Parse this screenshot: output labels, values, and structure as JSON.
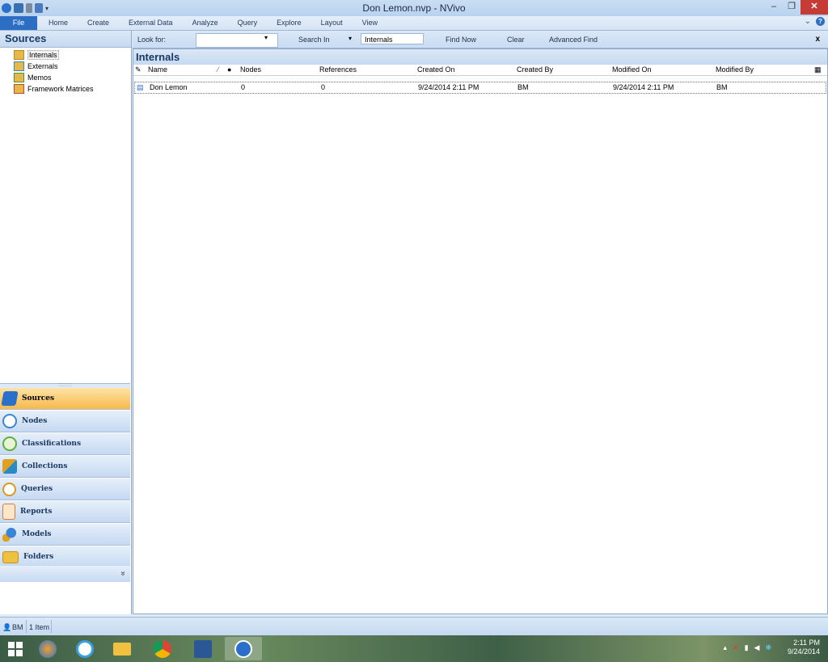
{
  "window": {
    "title": "Don Lemon.nvp - NVivo",
    "minimize": "–",
    "restore": "❐",
    "close": "✕"
  },
  "ribbon": {
    "tabs": [
      "File",
      "Home",
      "Create",
      "External Data",
      "Analyze",
      "Query",
      "Explore",
      "Layout",
      "View"
    ]
  },
  "sources_pane": {
    "title": "Sources",
    "items": [
      {
        "label": "Internals",
        "icon": "folder-open-icon"
      },
      {
        "label": "Externals",
        "icon": "externals-folder-icon"
      },
      {
        "label": "Memos",
        "icon": "memos-folder-icon"
      },
      {
        "label": "Framework Matrices",
        "icon": "framework-matrices-icon"
      }
    ]
  },
  "nav": {
    "grip": "::::::::::",
    "items": [
      {
        "label": "Sources",
        "icon": "sources-icon",
        "color": "#2a6fc9"
      },
      {
        "label": "Nodes",
        "icon": "nodes-icon",
        "color": "#3a86d6"
      },
      {
        "label": "Classifications",
        "icon": "classifications-icon",
        "color": "#5fae3d"
      },
      {
        "label": "Collections",
        "icon": "collections-icon",
        "color": "#e0a020"
      },
      {
        "label": "Queries",
        "icon": "queries-icon",
        "color": "#d99a20"
      },
      {
        "label": "Reports",
        "icon": "reports-icon",
        "color": "#d97a3a"
      },
      {
        "label": "Models",
        "icon": "models-icon",
        "color": "#3a86d6"
      },
      {
        "label": "Folders",
        "icon": "folders-icon",
        "color": "#f0c040"
      }
    ],
    "more_chevron": "»"
  },
  "findbar": {
    "look_for_label": "Look for:",
    "look_for_value": "",
    "search_in_label": "Search In",
    "search_in_value": "Internals",
    "find_now": "Find Now",
    "clear": "Clear",
    "advanced_find": "Advanced Find",
    "close": "x"
  },
  "list": {
    "title": "Internals",
    "columns": [
      "Name",
      "Nodes",
      "References",
      "Created On",
      "Created By",
      "Modified On",
      "Modified By"
    ],
    "rows": [
      {
        "name": "Don Lemon",
        "nodes": "0",
        "references": "0",
        "created_on": "9/24/2014 2:11 PM",
        "created_by": "BM",
        "modified_on": "9/24/2014 2:11 PM",
        "modified_by": "BM"
      }
    ]
  },
  "status": {
    "user": "BM",
    "count": "1 Item"
  },
  "taskbar": {
    "time": "2:11 PM",
    "date": "9/24/2014"
  }
}
